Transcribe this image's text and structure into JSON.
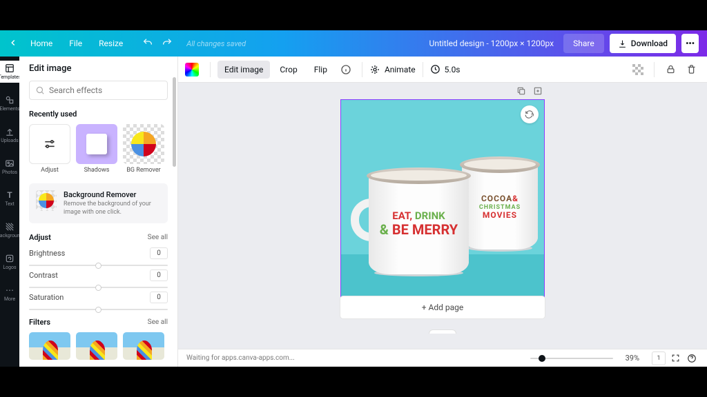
{
  "topbar": {
    "home": "Home",
    "file": "File",
    "resize": "Resize",
    "saved": "All changes saved",
    "doc_name": "Untitled design - 1200px × 1200px",
    "share": "Share",
    "download": "Download",
    "more": "•••"
  },
  "rail": {
    "items": [
      {
        "label": "Templates"
      },
      {
        "label": "Elements"
      },
      {
        "label": "Uploads"
      },
      {
        "label": "Photos"
      },
      {
        "label": "Text"
      },
      {
        "label": "Background"
      },
      {
        "label": "Logos"
      },
      {
        "label": "More"
      }
    ]
  },
  "panel": {
    "title": "Edit image",
    "search_placeholder": "Search effects",
    "recently_used": "Recently used",
    "recent": [
      {
        "label": "Adjust"
      },
      {
        "label": "Shadows"
      },
      {
        "label": "BG Remover"
      }
    ],
    "promo": {
      "title": "Background Remover",
      "desc": "Remove the background of your image with one click."
    },
    "adjust": {
      "title": "Adjust",
      "see_all": "See all",
      "brightness_label": "Brightness",
      "brightness_value": "0",
      "contrast_label": "Contrast",
      "contrast_value": "0",
      "saturation_label": "Saturation",
      "saturation_value": "0"
    },
    "filters": {
      "title": "Filters",
      "see_all": "See all"
    }
  },
  "toolbar": {
    "edit_image": "Edit image",
    "crop": "Crop",
    "flip": "Flip",
    "animate": "Animate",
    "duration": "5.0s"
  },
  "canvas": {
    "add_page": "+ Add page",
    "mug1_line1_a": "EAT,",
    "mug1_line1_b": " DRINK",
    "mug1_line2_a": "& ",
    "mug1_line2_b": "BE MERRY",
    "mug2_line1": "COCOA",
    "mug2_amp": "&",
    "mug2_line2": "CHRISTMAS",
    "mug2_line3": "MOVIES"
  },
  "bottombar": {
    "status": "Waiting for apps.canva-apps.com...",
    "zoom": "39%",
    "page_count": "1"
  }
}
